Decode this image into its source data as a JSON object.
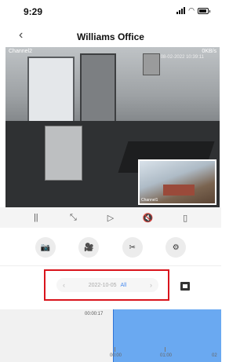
{
  "status_bar": {
    "time": "9:29"
  },
  "nav": {
    "back": "‹",
    "title": "Williams Office"
  },
  "video": {
    "channel_label": "Channel2",
    "bitrate": "0KB/s",
    "timestamp": "08-02-2022 10:39:11",
    "pip_label": "Channel1"
  },
  "controls": {
    "pause": "||",
    "fullscreen": "⤡",
    "play_next": "▷",
    "mute": "🔇",
    "rotate": "▯"
  },
  "tools": {
    "snapshot": "📷",
    "record": "🎥",
    "clip": "✂",
    "settings": "⚙"
  },
  "date_selector": {
    "prev_arrow": "‹",
    "date": "2022-10-05",
    "filter": "All",
    "next_arrow": "›"
  },
  "timeline": {
    "cursor_time": "00:00:17",
    "ticks": [
      "00:00",
      "01:00",
      "02"
    ]
  }
}
